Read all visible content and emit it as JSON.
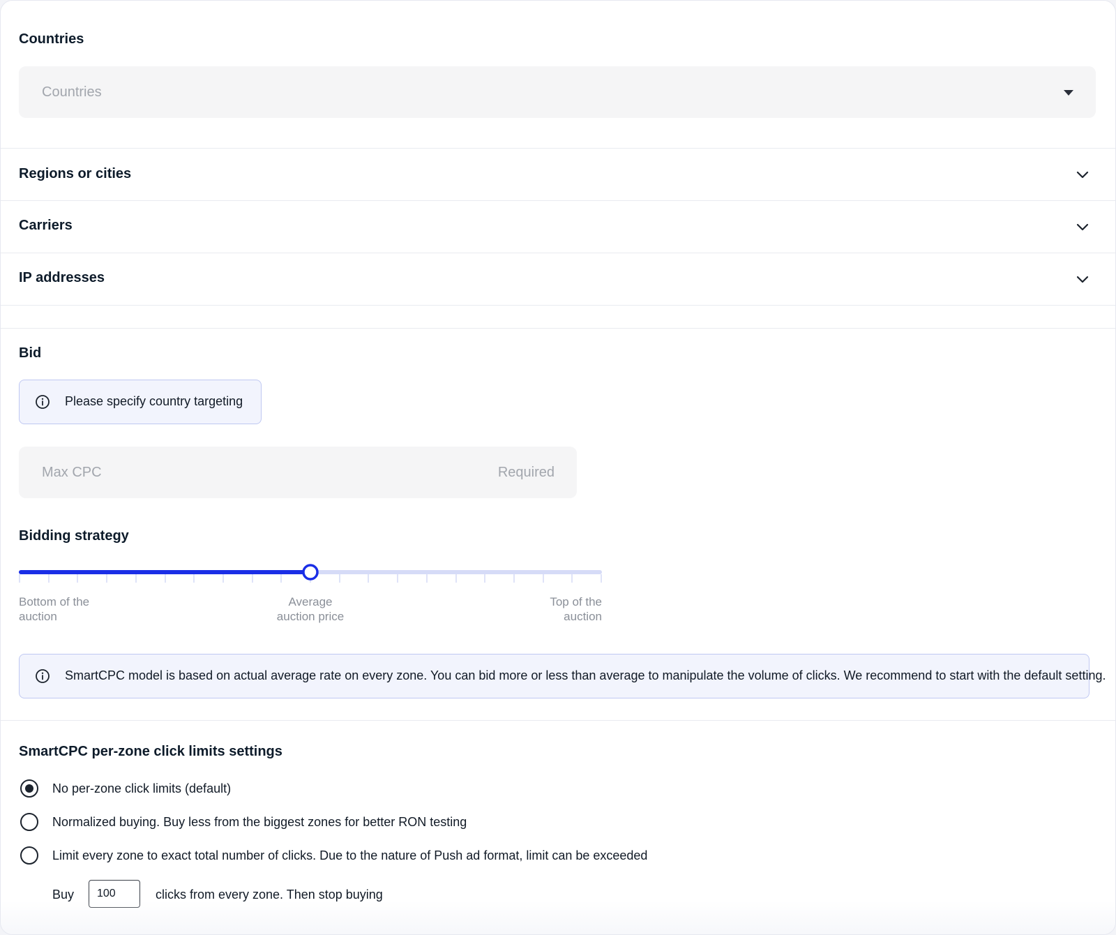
{
  "countries": {
    "title": "Countries",
    "placeholder": "Countries"
  },
  "collapsibles": [
    {
      "label": "Regions or cities"
    },
    {
      "label": "Carriers"
    },
    {
      "label": "IP addresses"
    }
  ],
  "bid": {
    "title": "Bid",
    "notice": "Please specify country targeting",
    "max_cpc_placeholder": "Max CPC",
    "max_cpc_hint": "Required"
  },
  "bidding_strategy": {
    "title": "Bidding strategy",
    "slider_value": 0.5,
    "tick_count": 21,
    "labels": {
      "left_line1": "Bottom of the",
      "left_line2": "auction",
      "mid_line1": "Average",
      "mid_line2": "auction price",
      "right_line1": "Top of the",
      "right_line2": "auction"
    },
    "accent_color": "#1a2ee6",
    "track_color": "#d6dbf7",
    "info": "SmartCPC model is based on actual average rate on every zone. You can bid more or less than average to manipulate the volume of clicks. We recommend to start with the default setting."
  },
  "click_limits": {
    "title": "SmartCPC per-zone click limits settings",
    "options": [
      {
        "label": "No per-zone click limits (default)",
        "selected": true
      },
      {
        "label": "Normalized buying. Buy less from the biggest zones for better RON testing",
        "selected": false
      },
      {
        "label": "Limit every zone to exact total number of clicks. Due to the nature of Push ad format, limit can be exceeded",
        "selected": false
      }
    ],
    "buy_prefix": "Buy",
    "buy_value": "100",
    "buy_suffix": "clicks from every zone. Then stop buying"
  }
}
